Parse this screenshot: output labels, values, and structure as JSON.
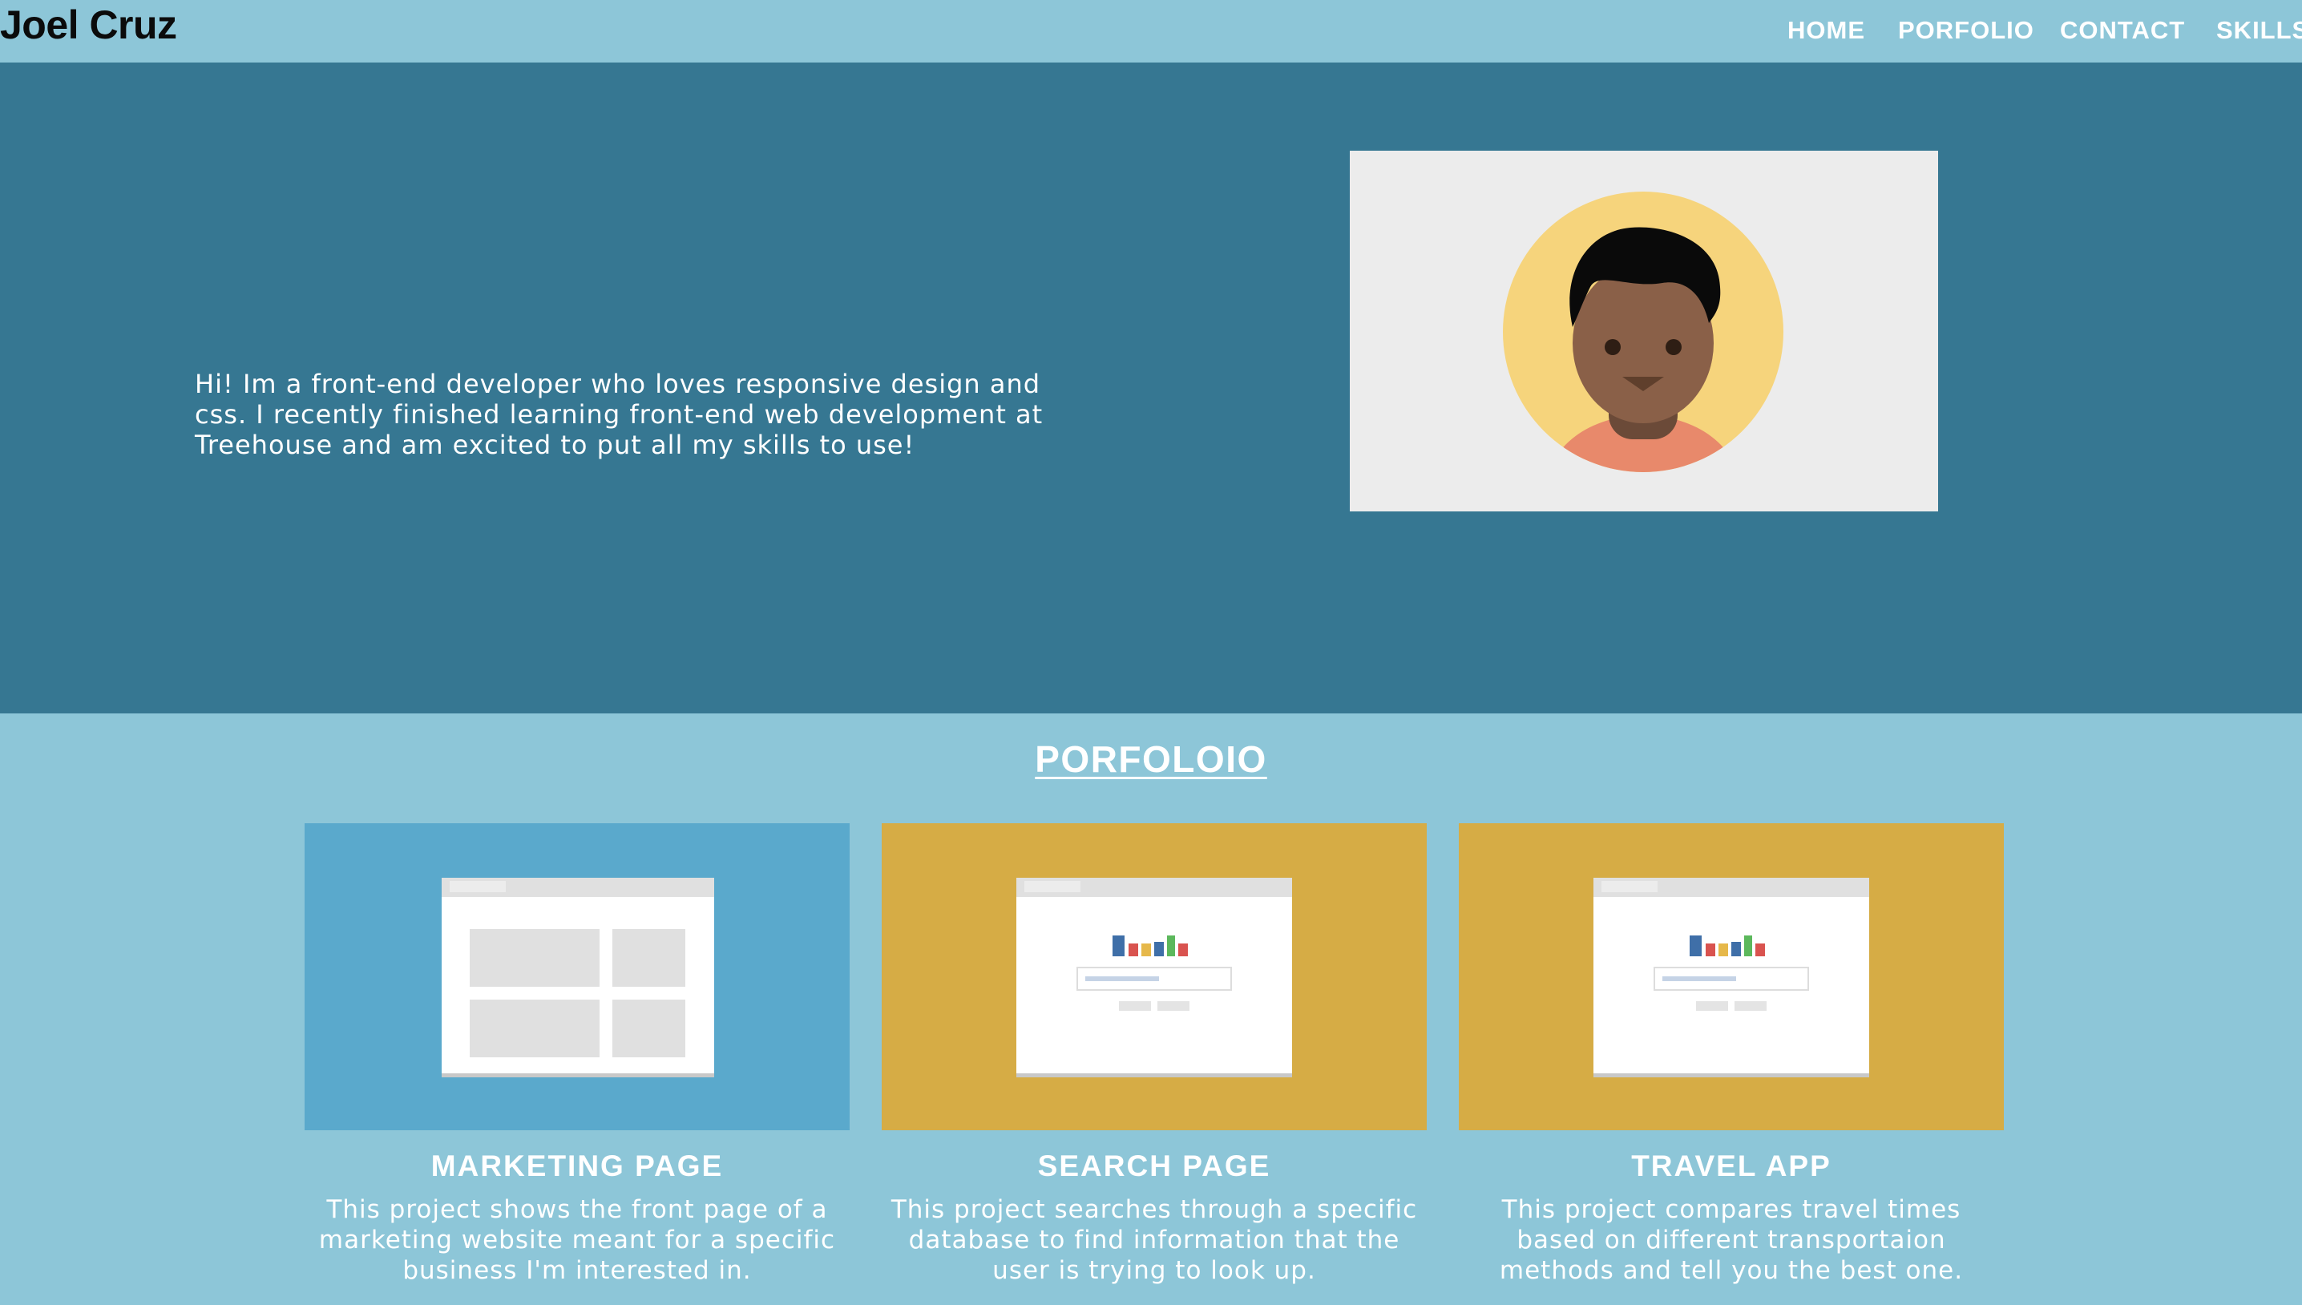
{
  "header": {
    "brand": "Joel Cruz",
    "nav": [
      "HOME",
      "PORFOLIO",
      "CONTACT",
      "SKILLS"
    ]
  },
  "hero": {
    "intro": "Hi! Im a front-end developer who loves responsive design and css. I recently finished learning front-end web development at Treehouse and am excited to put all my skills to use!",
    "avatar_icon": "person-avatar-icon"
  },
  "portfolio": {
    "title": "PORFOLOIO",
    "projects": [
      {
        "title": "MARKETING PAGE",
        "description": "This project shows the front page of a marketing website meant for a specific business I'm interested in.",
        "thumb_color": "#5aa9cc",
        "thumb_icon": "layout-grid-browser-icon"
      },
      {
        "title": "SEARCH PAGE",
        "description": "This project searches through a specific database to find information that the user is trying to look up.",
        "thumb_color": "#d6ac45",
        "thumb_icon": "search-browser-icon"
      },
      {
        "title": "TRAVEL APP",
        "description": "This project compares travel times based on different transportaion methods and tell you the best one.",
        "thumb_color": "#d6ac45",
        "thumb_icon": "search-browser-icon"
      }
    ]
  },
  "colors": {
    "page_bg": "#8dc6d8",
    "hero_bg": "#367792",
    "brand_text": "#0b0b0b"
  }
}
